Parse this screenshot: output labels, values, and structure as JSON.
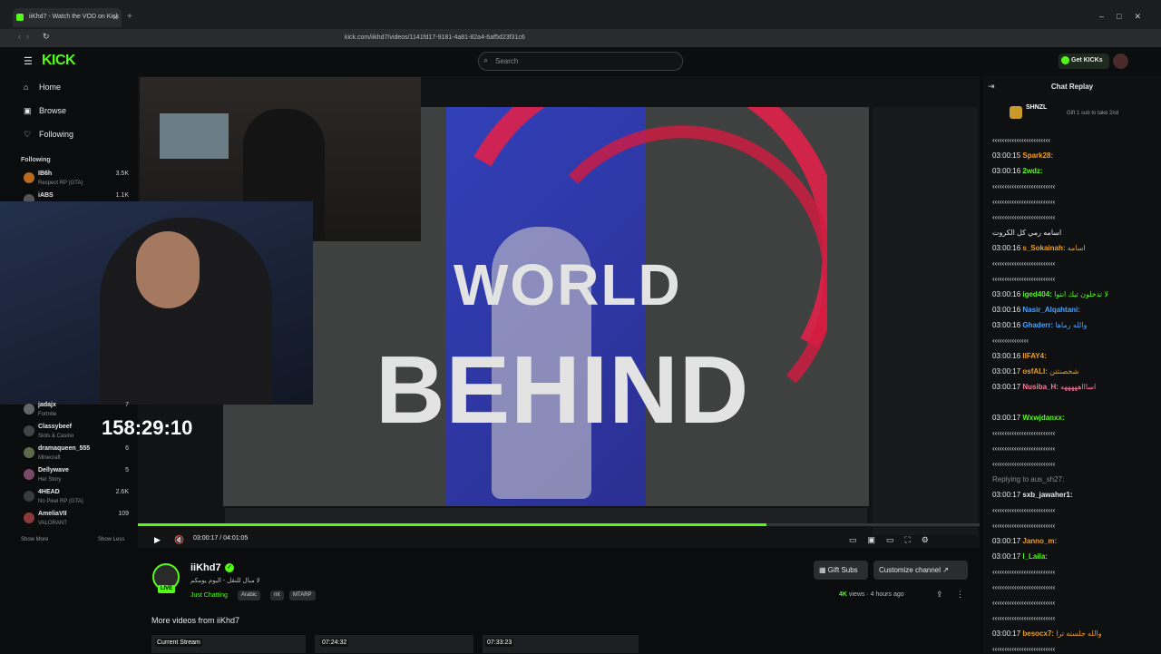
{
  "browser": {
    "tab_title": "iiKhd7 - Watch the VOD on Kick",
    "url": "kick.com/iikhd7/videos/1141fd17-9181-4a81-82a4-6af5d23f31c6"
  },
  "header": {
    "logo": "KICK",
    "search_placeholder": "Search",
    "get_kicks_label": "Get KICKs"
  },
  "sidebar": {
    "nav": [
      {
        "label": "Home",
        "icon": "home-icon"
      },
      {
        "label": "Browse",
        "icon": "browse-icon"
      },
      {
        "label": "Following",
        "icon": "heart-icon"
      }
    ],
    "following_title": "Following",
    "following": [
      {
        "name": "IB6h",
        "sub": "Respect RP (GTA)",
        "count": "3.5K"
      },
      {
        "name": "iABS",
        "sub": "",
        "count": "1.1K"
      },
      {
        "name": "jadajx",
        "sub": "Fortnite",
        "count": "7"
      },
      {
        "name": "Classybeef",
        "sub": "Slots & Casino",
        "count": "7"
      },
      {
        "name": "dramaqueen_555",
        "sub": "Minecraft",
        "count": "6"
      },
      {
        "name": "Dellywave",
        "sub": "Her Story",
        "count": "5"
      },
      {
        "name": "4HEAD",
        "sub": "No Pixel RP (GTA)",
        "count": "2.6K"
      },
      {
        "name": "AmeliaVII",
        "sub": "VALORANT",
        "count": "109"
      }
    ],
    "show_more": "Show More",
    "show_less": "Show Less"
  },
  "player": {
    "overlay_timer": "158:29:10",
    "video_text_line1": "WORLD",
    "video_text_line2": "BEHIND",
    "current_time": "03:00:17",
    "duration": "04:01:05",
    "time_display": "03:00:17 / 04:01:05",
    "progress": 0.747
  },
  "channel": {
    "name": "iiKhd7",
    "live_badge": "LIVE",
    "title": "لا مبال للنقل - اليوم يومكم",
    "category": "Just Chatting",
    "tags": [
      "Arabic",
      "mt",
      "MTARP"
    ],
    "gift_subs_label": "Gift Subs",
    "customize_label": "Customize channel",
    "views": "4K",
    "views_suffix": "views",
    "posted": "4 hours ago",
    "more_videos_title": "More videos from iiKhd7",
    "thumbnails": [
      {
        "label": "Current Stream",
        "duration": ""
      },
      {
        "label": "",
        "duration": "07:24:32"
      },
      {
        "label": "",
        "duration": "07:33:23"
      }
    ]
  },
  "chat": {
    "title": "Chat Replay",
    "pinned_user": "SHNZL",
    "pinned_text": "Gift 1 sub to take 2nd",
    "messages": [
      {
        "time": "",
        "user": "",
        "color": "#e8e8e8",
        "text": "‹‹‹‹‹‹‹‹‹‹‹‹‹‹‹‹‹‹‹‹‹‹‹‹"
      },
      {
        "time": "03:00:15",
        "user": "Spark28:",
        "color": "#f0a020",
        "text": ""
      },
      {
        "time": "03:00:16",
        "user": "2wdz:",
        "color": "#53fc18",
        "text": ""
      },
      {
        "time": "",
        "user": "",
        "color": "#e8e8e8",
        "text": "‹‹‹‹‹‹‹‹‹‹‹‹‹‹‹‹‹‹‹‹‹‹‹‹‹‹"
      },
      {
        "time": "",
        "user": "",
        "color": "#e8e8e8",
        "text": "‹‹‹‹‹‹‹‹‹‹‹‹‹‹‹‹‹‹‹‹‹‹‹‹‹‹"
      },
      {
        "time": "",
        "user": "",
        "color": "#e8e8e8",
        "text": "‹‹‹‹‹‹‹‹‹‹‹‹‹‹‹‹‹‹‹‹‹‹‹‹‹‹"
      },
      {
        "time": "",
        "user": "",
        "color": "#e8e8e8",
        "text": "اسامه رمي كل الكروت"
      },
      {
        "time": "03:00:16",
        "user": "s_Sokainah:",
        "color": "#f0a020",
        "text": "اسامه"
      },
      {
        "time": "",
        "user": "",
        "color": "#e8e8e8",
        "text": "‹‹‹‹‹‹‹‹‹‹‹‹‹‹‹‹‹‹‹‹‹‹‹‹‹‹"
      },
      {
        "time": "",
        "user": "",
        "color": "#e8e8e8",
        "text": "‹‹‹‹‹‹‹‹‹‹‹‹‹‹‹‹‹‹‹‹‹‹‹‹‹‹"
      },
      {
        "time": "03:00:16",
        "user": "iged404:",
        "color": "#53fc18",
        "text": "لا تدخلون تيك انتوا"
      },
      {
        "time": "03:00:16",
        "user": "Nasir_Alqahtani:",
        "color": "#4aa3ff",
        "text": ""
      },
      {
        "time": "03:00:16",
        "user": "Ghaderr:",
        "color": "#4aa3ff",
        "text": "والله رماها"
      },
      {
        "time": "",
        "user": "",
        "color": "#e8e8e8",
        "text": "‹‹‹‹‹‹‹‹‹‹‹‹‹‹‹"
      },
      {
        "time": "03:00:16",
        "user": "IIFAY4:",
        "color": "#f0a020",
        "text": ""
      },
      {
        "time": "03:00:17",
        "user": "osfALI:",
        "color": "#f0a020",
        "text": "شخصنتتن"
      },
      {
        "time": "03:00:17",
        "user": "Nusiba_H:",
        "color": "#ff7a9c",
        "text": "اساااهههههه"
      },
      {
        "time": "",
        "user": "",
        "color": "#e8e8e8",
        "text": ""
      },
      {
        "time": "03:00:17",
        "user": "Wxwjdanxx:",
        "color": "#53fc18",
        "text": ""
      },
      {
        "time": "",
        "user": "",
        "color": "#e8e8e8",
        "text": "‹‹‹‹‹‹‹‹‹‹‹‹‹‹‹‹‹‹‹‹‹‹‹‹‹‹"
      },
      {
        "time": "",
        "user": "",
        "color": "#e8e8e8",
        "text": "‹‹‹‹‹‹‹‹‹‹‹‹‹‹‹‹‹‹‹‹‹‹‹‹‹‹"
      },
      {
        "time": "",
        "user": "",
        "color": "#e8e8e8",
        "text": "‹‹‹‹‹‹‹‹‹‹‹‹‹‹‹‹‹‹‹‹‹‹‹‹‹‹"
      },
      {
        "time": "",
        "user": "",
        "color": "#8b8b8b",
        "text": "Replying to aus_sh27:"
      },
      {
        "time": "03:00:17",
        "user": "sxb_jawaher1:",
        "color": "#e8e8e8",
        "text": ""
      },
      {
        "time": "",
        "user": "",
        "color": "#e8e8e8",
        "text": "‹‹‹‹‹‹‹‹‹‹‹‹‹‹‹‹‹‹‹‹‹‹‹‹‹‹"
      },
      {
        "time": "",
        "user": "",
        "color": "#e8e8e8",
        "text": "‹‹‹‹‹‹‹‹‹‹‹‹‹‹‹‹‹‹‹‹‹‹‹‹‹‹"
      },
      {
        "time": "03:00:17",
        "user": "Janno_m:",
        "color": "#f0a020",
        "text": ""
      },
      {
        "time": "03:00:17",
        "user": "l_Laila:",
        "color": "#53fc18",
        "text": ""
      },
      {
        "time": "",
        "user": "",
        "color": "#e8e8e8",
        "text": "‹‹‹‹‹‹‹‹‹‹‹‹‹‹‹‹‹‹‹‹‹‹‹‹‹‹"
      },
      {
        "time": "",
        "user": "",
        "color": "#e8e8e8",
        "text": "‹‹‹‹‹‹‹‹‹‹‹‹‹‹‹‹‹‹‹‹‹‹‹‹‹‹"
      },
      {
        "time": "",
        "user": "",
        "color": "#e8e8e8",
        "text": "‹‹‹‹‹‹‹‹‹‹‹‹‹‹‹‹‹‹‹‹‹‹‹‹‹‹"
      },
      {
        "time": "",
        "user": "",
        "color": "#e8e8e8",
        "text": "‹‹‹‹‹‹‹‹‹‹‹‹‹‹‹‹‹‹‹‹‹‹‹‹‹‹"
      },
      {
        "time": "03:00:17",
        "user": "besocx7:",
        "color": "#f0a020",
        "text": "والله جلسته ترا"
      },
      {
        "time": "",
        "user": "",
        "color": "#e8e8e8",
        "text": "‹‹‹‹‹‹‹‹‹‹‹‹‹‹‹‹‹‹‹‹‹‹‹‹‹‹"
      }
    ]
  },
  "colors": {
    "accent": "#53fc18",
    "background": "#0b0c0d"
  }
}
